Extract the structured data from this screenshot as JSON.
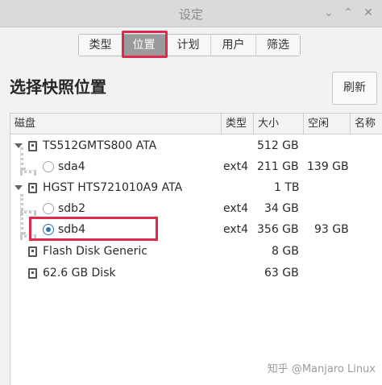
{
  "window": {
    "title": "设定"
  },
  "tabs": [
    {
      "label": "类型",
      "active": false
    },
    {
      "label": "位置",
      "active": true
    },
    {
      "label": "计划",
      "active": false
    },
    {
      "label": "用户",
      "active": false
    },
    {
      "label": "筛选",
      "active": false
    }
  ],
  "page": {
    "heading": "选择快照位置",
    "refresh_label": "刷新"
  },
  "table": {
    "columns": [
      "磁盘",
      "类型",
      "大小",
      "空闲",
      "名称"
    ],
    "rows": [
      {
        "kind": "disk",
        "name": "TS512GMTS800 ATA",
        "type": "",
        "size": "512 GB",
        "free": ""
      },
      {
        "kind": "partition",
        "name": "sda4",
        "type": "ext4",
        "size": "211 GB",
        "free": "139 GB",
        "selected": false
      },
      {
        "kind": "disk",
        "name": "HGST HTS721010A9 ATA",
        "type": "",
        "size": "1 TB",
        "free": ""
      },
      {
        "kind": "partition",
        "name": "sdb2",
        "type": "ext4",
        "size": "34 GB",
        "free": "",
        "selected": false
      },
      {
        "kind": "partition",
        "name": "sdb4",
        "type": "ext4",
        "size": "356 GB",
        "free": "93 GB",
        "selected": true
      },
      {
        "kind": "disk-flat",
        "name": "Flash Disk Generic",
        "type": "",
        "size": "8 GB",
        "free": ""
      },
      {
        "kind": "disk-flat",
        "name": "62.6 GB Disk",
        "type": "",
        "size": "63 GB",
        "free": ""
      }
    ]
  },
  "watermark": "知乎 @Manjaro Linux"
}
